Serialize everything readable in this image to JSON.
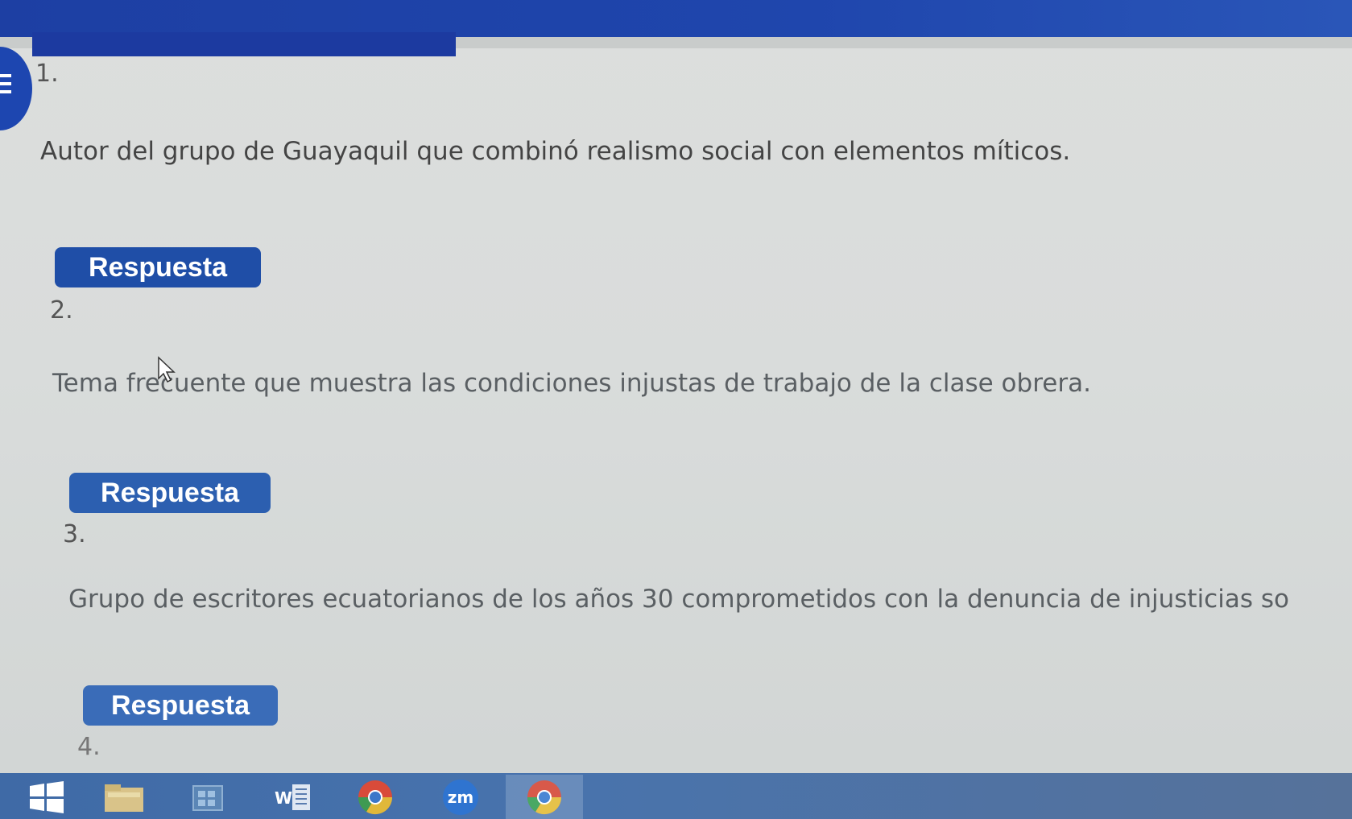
{
  "questions": [
    {
      "number": "1.",
      "text": "Autor del grupo de Guayaquil que combinó realismo social con elementos míticos.",
      "answer_label": "Respuesta"
    },
    {
      "number": "2.",
      "text": "Tema frecuente que muestra las condiciones injustas de trabajo de la clase obrera.",
      "answer_label": "Respuesta"
    },
    {
      "number": "3.",
      "text": "Grupo de escritores ecuatorianos de los años 30 comprometidos con la denuncia de injusticias so",
      "answer_label": "Respuesta"
    },
    {
      "number": "4."
    }
  ],
  "taskbar": {
    "zoom_label": "zm",
    "word_label": "W"
  },
  "colors": {
    "header": "#1d3fa3",
    "button": "#1f4ea7",
    "taskbar": "#4873ad"
  },
  "icons": [
    "menu-icon",
    "windows-start-icon",
    "file-explorer-icon",
    "store-icon",
    "word-icon",
    "chrome-icon",
    "zoom-icon",
    "chrome-canary-icon",
    "mouse-cursor-icon"
  ]
}
